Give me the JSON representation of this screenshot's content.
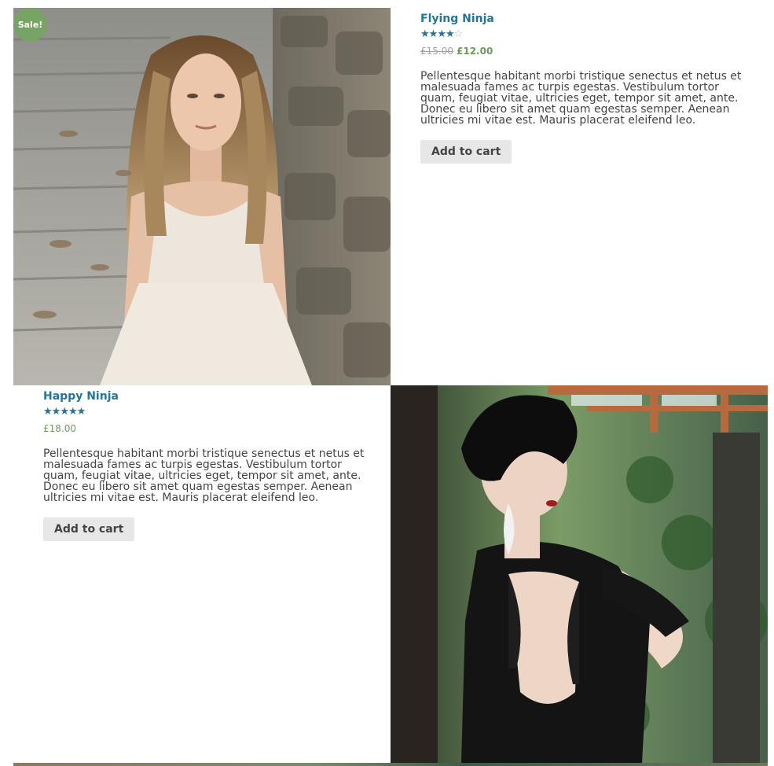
{
  "products": [
    {
      "title": "Flying Ninja",
      "rating": 4,
      "rating_max": 5,
      "sale_badge": "Sale!",
      "price_old": "£15.00",
      "price_new": "£12.00",
      "description": "Pellentesque habitant morbi tristique senectus et netus et malesuada fames ac turpis egestas. Vestibulum tortor quam, feugiat vitae, ultricies eget, tempor sit amet, ante. Donec eu libero sit amet quam egestas semper. Aenean ultricies mi vitae est. Mauris placerat eleifend leo.",
      "button_label": "Add to cart",
      "image_alt": "woman in white dress on stone steps"
    },
    {
      "title": "Happy Ninja",
      "rating": 5,
      "rating_max": 5,
      "price": "£18.00",
      "description": "Pellentesque habitant morbi tristique senectus et netus et malesuada fames ac turpis egestas. Vestibulum tortor quam, feugiat vitae, ultricies eget, tempor sit amet, ante. Donec eu libero sit amet quam egestas semper. Aenean ultricies mi vitae est. Mauris placerat eleifend leo.",
      "button_label": "Add to cart",
      "image_alt": "woman in black lace dress"
    }
  ],
  "colors": {
    "title": "#22769b",
    "star": "#22769b",
    "sale": "#77a464",
    "price": "#6e9a5c",
    "button_bg": "#e8e7e8"
  },
  "icons": {
    "star_full": "star-icon",
    "star_empty": "star-outline-icon"
  }
}
